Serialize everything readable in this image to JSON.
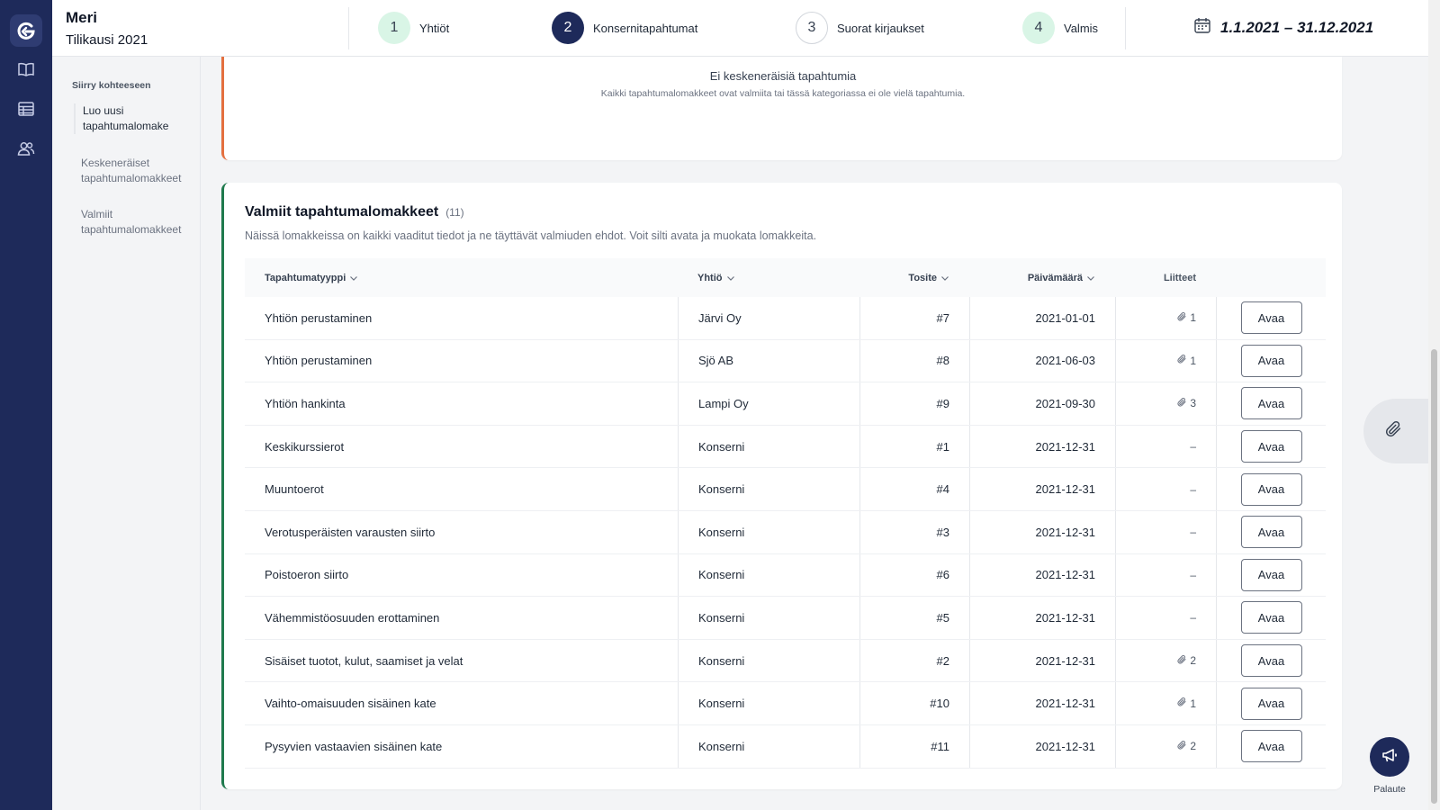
{
  "header": {
    "company_name": "Meri",
    "period": "Tilikausi 2021",
    "steps": [
      {
        "number": "1",
        "label": "Yhtiöt",
        "state": "done"
      },
      {
        "number": "2",
        "label": "Konsernitapahtumat",
        "state": "active"
      },
      {
        "number": "3",
        "label": "Suorat kirjaukset",
        "state": "todo"
      },
      {
        "number": "4",
        "label": "Valmis",
        "state": "done"
      }
    ],
    "date_range": "1.1.2021 – 31.12.2021",
    "calendar_icon": "calendar-icon"
  },
  "rail": {
    "icons": [
      "logo-icon",
      "book-icon",
      "table-icon",
      "users-icon"
    ]
  },
  "subnav": {
    "title": "Siirry kohteeseen",
    "items": [
      {
        "label": "Luo uusi tapahtumalomake",
        "active": true
      },
      {
        "label": "Keskeneräiset tapahtumalomakkeet",
        "active": false
      },
      {
        "label": "Valmiit tapahtumalomakkeet",
        "active": false
      }
    ]
  },
  "incomplete": {
    "empty_title": "Ei keskeneräisiä tapahtumia",
    "empty_subtitle": "Kaikki tapahtumalomakkeet ovat valmiita tai tässä kategoriassa ei ole vielä tapahtumia."
  },
  "completed": {
    "title": "Valmiit tapahtumalomakkeet",
    "count": "(11)",
    "description": "Näissä lomakkeissa on kaikki vaaditut tiedot ja ne täyttävät valmiuden ehdot. Voit silti avata ja muokata lomakkeita.",
    "columns": {
      "type": "Tapahtumatyyppi",
      "company": "Yhtiö",
      "voucher": "Tosite",
      "date": "Päivämäärä",
      "attachments": "Liitteet"
    },
    "open_label": "Avaa",
    "rows": [
      {
        "type": "Yhtiön perustaminen",
        "company": "Järvi Oy",
        "voucher": "#7",
        "date": "2021-01-01",
        "attachments": "1"
      },
      {
        "type": "Yhtiön perustaminen",
        "company": "Sjö AB",
        "voucher": "#8",
        "date": "2021-06-03",
        "attachments": "1"
      },
      {
        "type": "Yhtiön hankinta",
        "company": "Lampi Oy",
        "voucher": "#9",
        "date": "2021-09-30",
        "attachments": "3"
      },
      {
        "type": "Keskikurssierot",
        "company": "Konserni",
        "voucher": "#1",
        "date": "2021-12-31",
        "attachments": "–"
      },
      {
        "type": "Muuntoerot",
        "company": "Konserni",
        "voucher": "#4",
        "date": "2021-12-31",
        "attachments": "–"
      },
      {
        "type": "Verotusperäisten varausten siirto",
        "company": "Konserni",
        "voucher": "#3",
        "date": "2021-12-31",
        "attachments": "–"
      },
      {
        "type": "Poistoeron siirto",
        "company": "Konserni",
        "voucher": "#6",
        "date": "2021-12-31",
        "attachments": "–"
      },
      {
        "type": "Vähemmistöosuuden erottaminen",
        "company": "Konserni",
        "voucher": "#5",
        "date": "2021-12-31",
        "attachments": "–"
      },
      {
        "type": "Sisäiset tuotot, kulut, saamiset ja velat",
        "company": "Konserni",
        "voucher": "#2",
        "date": "2021-12-31",
        "attachments": "2"
      },
      {
        "type": "Vaihto-omaisuuden sisäinen kate",
        "company": "Konserni",
        "voucher": "#10",
        "date": "2021-12-31",
        "attachments": "1"
      },
      {
        "type": "Pysyvien vastaavien sisäinen kate",
        "company": "Konserni",
        "voucher": "#11",
        "date": "2021-12-31",
        "attachments": "2"
      }
    ]
  },
  "floating": {
    "attach_icon": "paperclip-icon",
    "feedback_label": "Palaute",
    "feedback_icon": "megaphone-icon"
  },
  "colors": {
    "navy": "#1e2a5a",
    "done_step": "#d9f5e6",
    "incomplete_accent": "#e4703f",
    "complete_accent": "#1f7a4d"
  }
}
